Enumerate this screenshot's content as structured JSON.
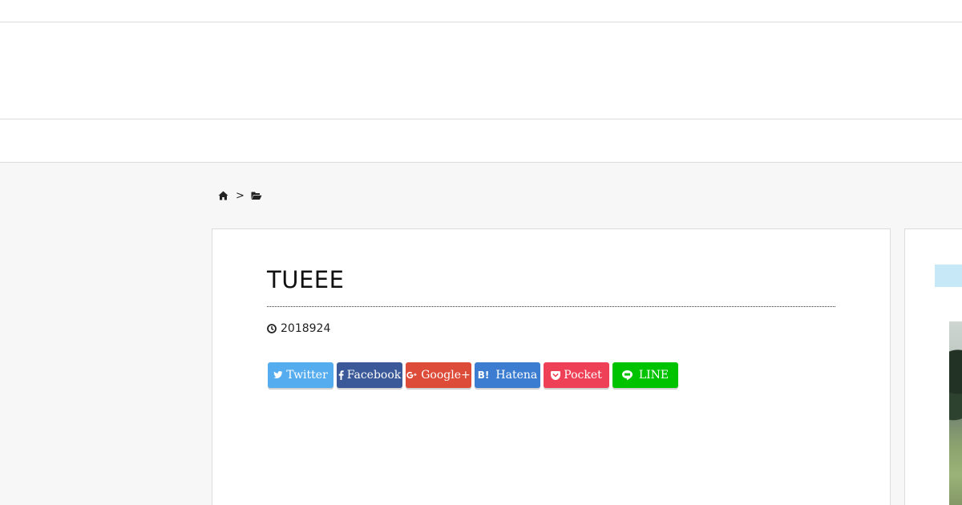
{
  "breadcrumb": {
    "home_icon": "home-icon",
    "separator": ">",
    "category_icon": "folder-open-icon"
  },
  "article": {
    "title": "TUEEE",
    "date_icon": "clock-icon",
    "date": "2018924"
  },
  "share_buttons": [
    {
      "label": "Twitter",
      "icon": "twitter-icon",
      "color": "#55acee"
    },
    {
      "label": "Facebook",
      "icon": "facebook-icon",
      "color": "#3b5998"
    },
    {
      "label": "Google+",
      "icon": "google-plus-icon",
      "color": "#dd4b39"
    },
    {
      "label": "Hatena",
      "icon": "hatena-bookmark-icon",
      "color": "#3c7dd1"
    },
    {
      "label": "Pocket",
      "icon": "pocket-icon",
      "color": "#ee4056"
    },
    {
      "label": "LINE",
      "icon": "line-icon",
      "color": "#00c300"
    }
  ],
  "colors": {
    "page_background": "#f7f7f7",
    "panel_background": "#ffffff",
    "border": "#dcdcdc",
    "sidebar_label": "#c7e9f7"
  }
}
